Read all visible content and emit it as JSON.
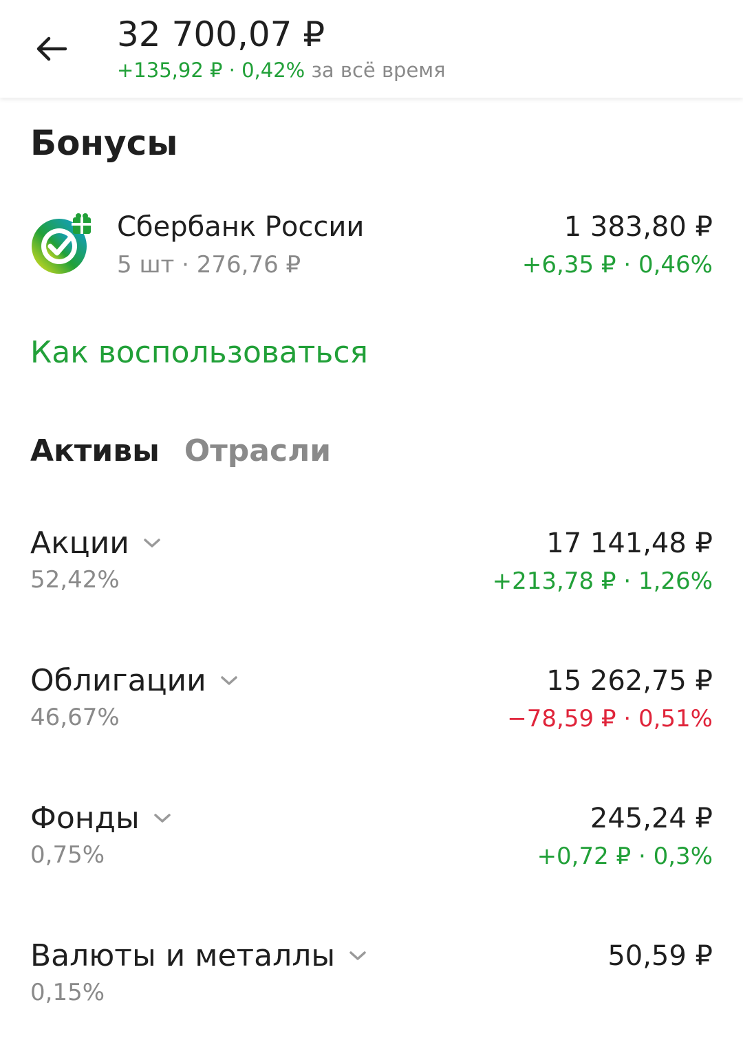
{
  "header": {
    "total": "32 700,07 ₽",
    "change_value": "+135,92 ₽ · 0,42%",
    "change_suffix": " за всё время"
  },
  "bonuses": {
    "title": "Бонусы",
    "holding": {
      "name": "Сбербанк России",
      "sub": "5 шт · 276,76 ₽",
      "value": "1 383,80 ₽",
      "change": "+6,35 ₽ · 0,46%",
      "logo_icon": "sberbank-gift-logo-icon"
    },
    "how_to_link": "Как воспользоваться"
  },
  "tabs": [
    {
      "label": "Активы",
      "active": true
    },
    {
      "label": "Отрасли",
      "active": false
    }
  ],
  "assets": [
    {
      "name": "Акции",
      "percent": "52,42%",
      "value": "17 141,48 ₽",
      "change": "+213,78 ₽ · 1,26%",
      "trend": "up"
    },
    {
      "name": "Облигации",
      "percent": "46,67%",
      "value": "15 262,75 ₽",
      "change": "−78,59 ₽ · 0,51%",
      "trend": "down"
    },
    {
      "name": "Фонды",
      "percent": "0,75%",
      "value": "245,24 ₽",
      "change": "+0,72 ₽ · 0,3%",
      "trend": "up"
    },
    {
      "name": "Валюты и металлы",
      "percent": "0,15%",
      "value": "50,59 ₽",
      "change": "",
      "trend": "none"
    }
  ],
  "colors": {
    "positive": "#21a038",
    "negative": "#e0243a",
    "muted": "#8a8a8a",
    "text": "#1f1f1f"
  }
}
